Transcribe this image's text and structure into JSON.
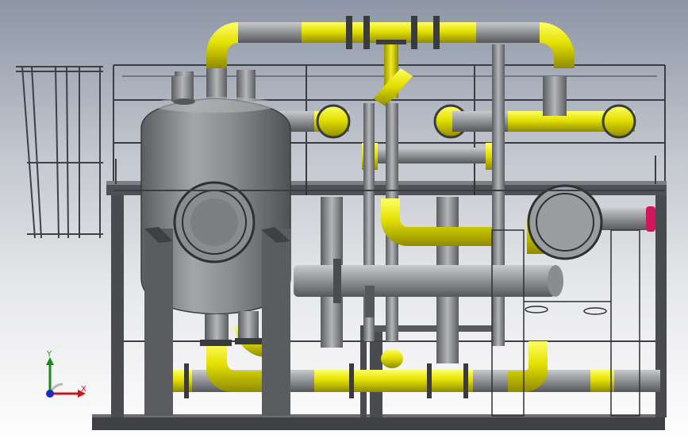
{
  "viewport": {
    "title": "",
    "background_gradient": [
      "#8d96a6",
      "#ffffff"
    ]
  },
  "model": {
    "name": "",
    "colors": {
      "pipe_yellow": "#e3e000",
      "pipe_gray": "#8a8c90",
      "vessel_gray": "#7a7c80",
      "frame_dark": "#4a4b4e",
      "flange_pink": "#d0165c"
    }
  },
  "triad": {
    "x_label": "X",
    "y_label": "Y",
    "x_color": "#c01b1b",
    "y_color": "#1b8a1b",
    "z_color": "#1b2cc0"
  }
}
